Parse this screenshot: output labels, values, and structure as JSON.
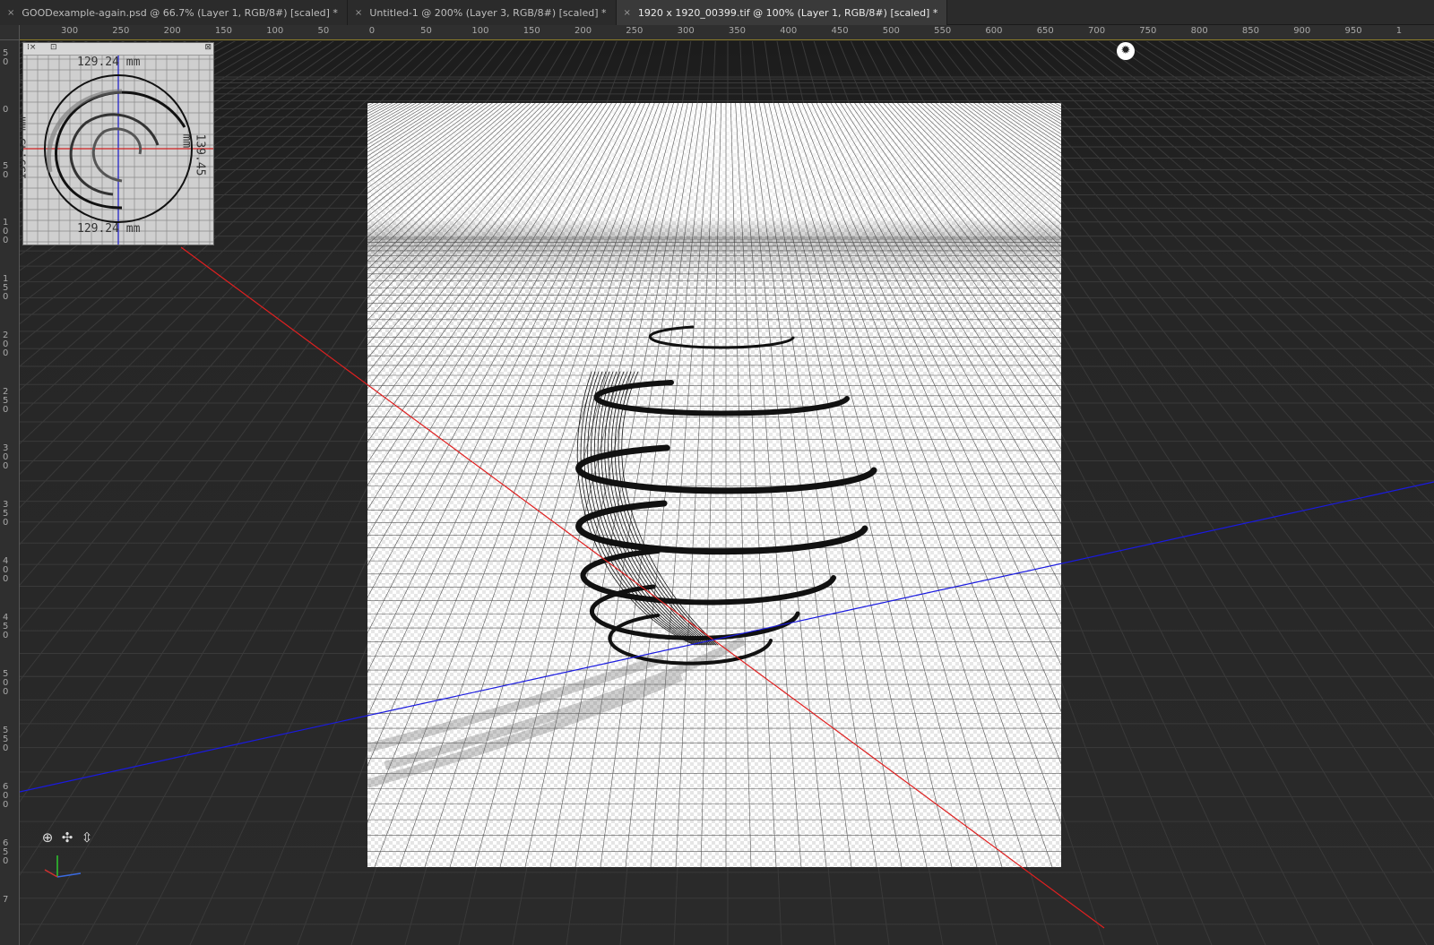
{
  "tabs": [
    {
      "label": "GOODexample-again.psd @ 66.7% (Layer 1, RGB/8#) [scaled] *",
      "close": "×"
    },
    {
      "label": "Untitled-1 @ 200% (Layer 3, RGB/8#) [scaled] *",
      "close": "×"
    },
    {
      "label": "1920 x 1920_00399.tif @ 100% (Layer 1, RGB/8#) [scaled] *",
      "close": "×"
    }
  ],
  "hruler": {
    "ticks": [
      "300",
      "250",
      "200",
      "150",
      "100",
      "50",
      "0",
      "50",
      "100",
      "150",
      "200",
      "250",
      "300",
      "350",
      "400",
      "450",
      "500",
      "550",
      "600",
      "650",
      "700",
      "750",
      "800",
      "850",
      "900",
      "950",
      "1"
    ]
  },
  "vruler": {
    "ticks": [
      "50",
      "0",
      "50",
      "100",
      "150",
      "200",
      "250",
      "300",
      "350",
      "400",
      "450",
      "500",
      "550",
      "600",
      "650",
      "7"
    ]
  },
  "minimap": {
    "top_label": "129.24 mm",
    "bottom_label": "129.24 mm",
    "left_label": "139.45 mm",
    "right_label": "139.45 mm"
  },
  "icons": {
    "light": "light-source-icon",
    "orbit": "orbit-3d-icon",
    "pan": "pan-3d-icon",
    "slide": "slide-3d-icon"
  },
  "colors": {
    "x_axis": "#e02020",
    "z_axis": "#1a1ae0",
    "ruler_accent": "#8a7a2a"
  }
}
